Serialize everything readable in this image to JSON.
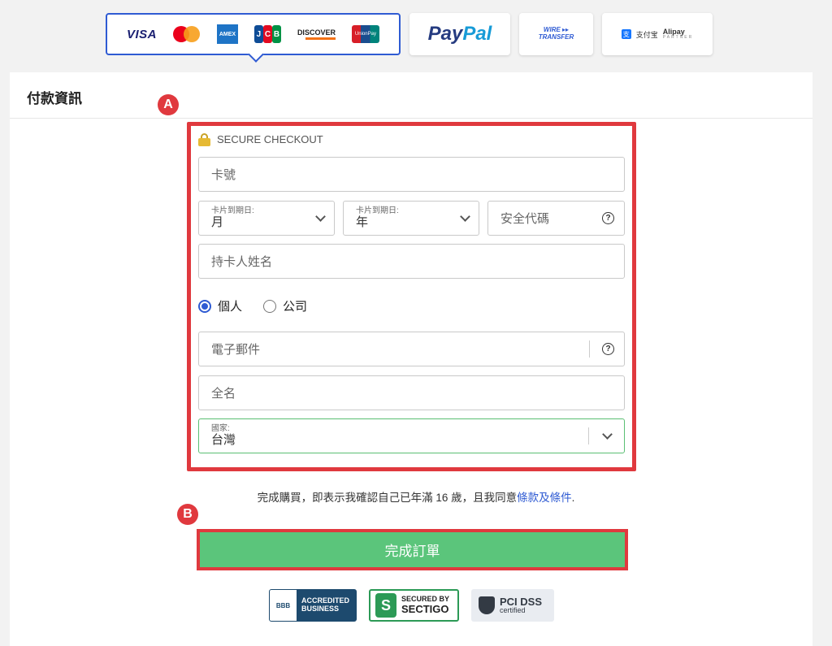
{
  "payment_methods": {
    "cards": [
      "VISA",
      "Mastercard",
      "AMEX",
      "JCB",
      "DISCOVER",
      "UnionPay"
    ],
    "paypal": {
      "p1": "Pay",
      "p2": "Pal"
    },
    "wire": {
      "line1": "WIRE ▸▸",
      "line2": "TRANSFER"
    },
    "alipay": {
      "cn": "支付宝",
      "partner": "Alipay",
      "partner_sub": "PARTNER"
    }
  },
  "panel": {
    "title": "付款資訊"
  },
  "markers": {
    "a": "A",
    "b": "B"
  },
  "form": {
    "secure_label": "SECURE CHECKOUT",
    "card_number_placeholder": "卡號",
    "expiry_month": {
      "label": "卡片到期日:",
      "value": "月"
    },
    "expiry_year": {
      "label": "卡片到期日:",
      "value": "年"
    },
    "cvv_placeholder": "安全代碼",
    "cardholder_placeholder": "持卡人姓名",
    "account_type": {
      "options": [
        "個人",
        "公司"
      ],
      "selected": "個人"
    },
    "email_placeholder": "電子郵件",
    "fullname_placeholder": "全名",
    "country": {
      "label": "國家:",
      "value": "台灣"
    }
  },
  "terms": {
    "text": "完成購買，即表示我確認自己已年滿 16 歲，且我同意",
    "link": "條款及條件",
    "end": "."
  },
  "submit_label": "完成訂單",
  "badges": {
    "bbb": {
      "logo": "BBB",
      "line1": "ACCREDITED",
      "line2": "BUSINESS"
    },
    "sectigo": {
      "line1": "SECURED BY",
      "line2": "SECTIGO"
    },
    "pci": {
      "line1": "PCI DSS",
      "line2": "certified"
    }
  }
}
